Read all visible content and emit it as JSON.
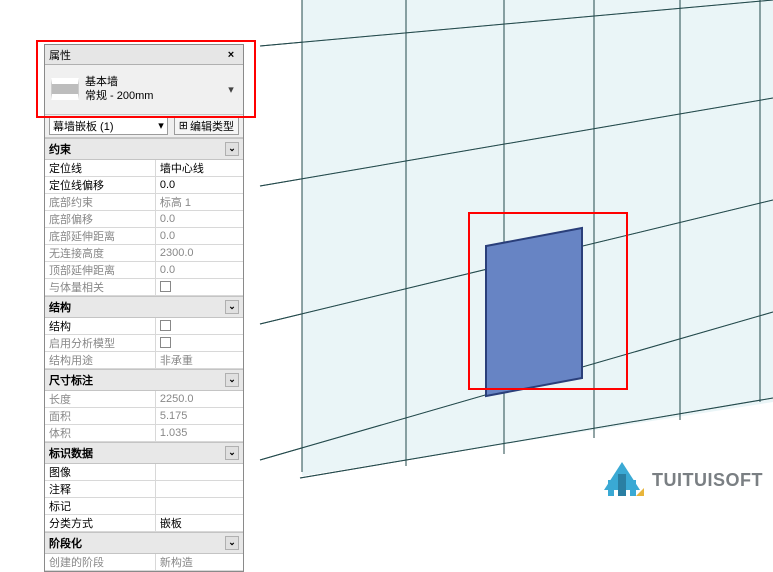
{
  "panel": {
    "title": "属性",
    "close": "×",
    "typeSelector": {
      "name": "基本墙",
      "variant": "常规 - 200mm"
    },
    "instance": {
      "label": "幕墙嵌板 (1)",
      "drop": "▾",
      "editType": "编辑类型"
    },
    "groups": [
      {
        "name": "约束",
        "rows": [
          {
            "label": "定位线",
            "value": "墙中心线",
            "disabled": false
          },
          {
            "label": "定位线偏移",
            "value": "0.0",
            "disabled": false
          },
          {
            "label": "底部约束",
            "value": "标高 1",
            "disabled": true
          },
          {
            "label": "底部偏移",
            "value": "0.0",
            "disabled": true
          },
          {
            "label": "底部延伸距离",
            "value": "0.0",
            "disabled": true
          },
          {
            "label": "无连接高度",
            "value": "2300.0",
            "disabled": true
          },
          {
            "label": "顶部延伸距离",
            "value": "0.0",
            "disabled": true
          },
          {
            "label": "与体量相关",
            "value": "__check__",
            "disabled": true
          }
        ]
      },
      {
        "name": "结构",
        "rows": [
          {
            "label": "结构",
            "value": "__check__",
            "disabled": false
          },
          {
            "label": "启用分析模型",
            "value": "__check__",
            "disabled": true
          },
          {
            "label": "结构用途",
            "value": "非承重",
            "disabled": true
          }
        ]
      },
      {
        "name": "尺寸标注",
        "rows": [
          {
            "label": "长度",
            "value": "2250.0",
            "disabled": true
          },
          {
            "label": "面积",
            "value": "5.175",
            "disabled": true
          },
          {
            "label": "体积",
            "value": "1.035",
            "disabled": true
          }
        ]
      },
      {
        "name": "标识数据",
        "rows": [
          {
            "label": "图像",
            "value": "",
            "disabled": false
          },
          {
            "label": "注释",
            "value": "",
            "disabled": false
          },
          {
            "label": "标记",
            "value": "",
            "disabled": false
          },
          {
            "label": "分类方式",
            "value": "嵌板",
            "disabled": false
          }
        ]
      },
      {
        "name": "阶段化",
        "rows": [
          {
            "label": "创建的阶段",
            "value": "新构造",
            "disabled": true
          }
        ]
      }
    ]
  },
  "watermark": {
    "text": "TUITUISOFT"
  },
  "chevron": "⌄"
}
